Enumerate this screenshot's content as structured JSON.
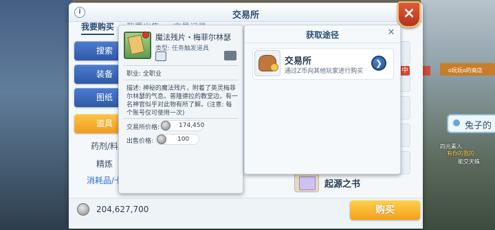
{
  "window": {
    "title": "交易所",
    "info_icon": "i",
    "close_icon": "×"
  },
  "tabs": [
    "我要购买",
    "我要出售",
    "交易记录"
  ],
  "categories": [
    {
      "label": "搜索"
    },
    {
      "label": "装备"
    },
    {
      "label": "图纸"
    },
    {
      "label": "道具"
    }
  ],
  "subcategories": [
    "药剂/料",
    "精炼",
    "消耗品/卡"
  ],
  "list": {
    "badge": "中",
    "book_name": "起源之书"
  },
  "background": {
    "bubble": "兔子的",
    "sign": "o玩玩o的商店",
    "npc_a": "四元素人",
    "npc_b": "有你的我的",
    "npc_c": "能交天蛛"
  },
  "tooltip": {
    "name": "魔法残片・梅菲尔林瑟",
    "type": "类型: 任务触发道具",
    "job": "职业: 全职业",
    "description": "描述: 神秘的魔法残片，附着了英灵梅菲尔林瑟的气息。普隆德拉的教堂边，有一名神官似乎对此物有所了解。(注意: 每个账号仅可使用一次)",
    "market_price_label": "交易所价格:",
    "market_price": "174,450",
    "sell_price_label": "出售价格:",
    "sell_price": "100"
  },
  "route": {
    "title": "获取途径",
    "source_name": "交易所",
    "source_desc": "通过Z币向其他玩家进行购买",
    "go_icon": "❯"
  },
  "footer": {
    "coins": "204,627,700",
    "buy_label": "购买"
  }
}
